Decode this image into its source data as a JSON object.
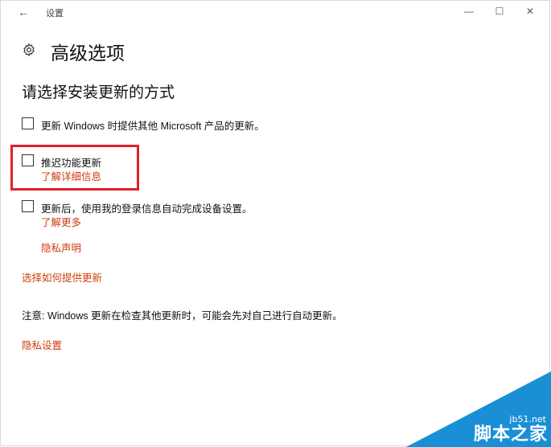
{
  "window": {
    "title": "设置",
    "back_icon": "back-arrow-icon",
    "controls": {
      "minimize": "—",
      "maximize": "☐",
      "close": "✕"
    }
  },
  "header": {
    "icon": "gear-icon",
    "title": "高级选项"
  },
  "section": {
    "title": "请选择安装更新的方式"
  },
  "options": [
    {
      "label": "更新 Windows 时提供其他 Microsoft 产品的更新。",
      "checked": false
    },
    {
      "label": "推迟功能更新",
      "checked": false,
      "link": "了解详细信息"
    },
    {
      "label": "更新后，使用我的登录信息自动完成设备设置。",
      "checked": false,
      "link": "了解更多"
    }
  ],
  "links": {
    "privacy_statement": "隐私声明",
    "choose_delivery": "选择如何提供更新",
    "privacy_settings": "隐私设置"
  },
  "note": "注意: Windows 更新在检查其他更新时，可能会先对自己进行自动更新。",
  "watermark": {
    "site": "jb51.net",
    "name": "脚本之家"
  },
  "colors": {
    "link": "#d03c0c",
    "highlight": "#e0202a",
    "watermark": "#1a8fd6"
  }
}
